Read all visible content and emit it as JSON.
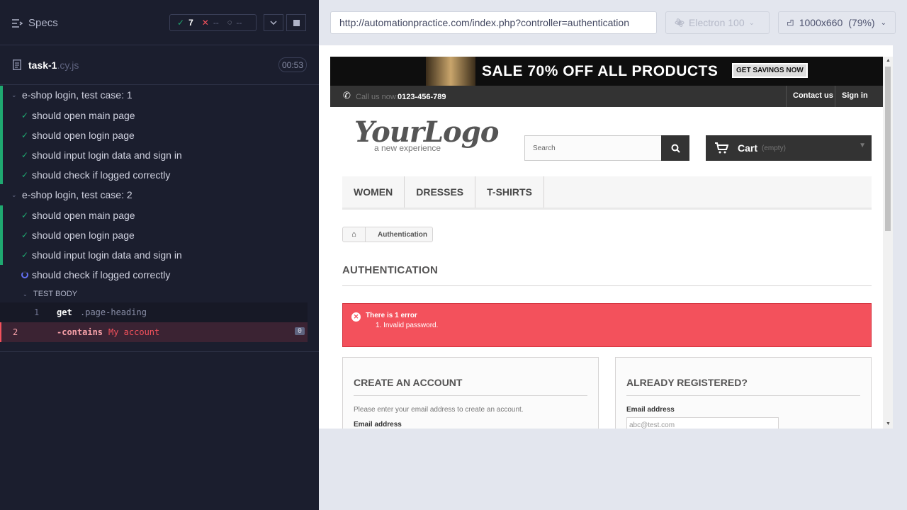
{
  "header": {
    "specs_label": "Specs",
    "passed_count": "7",
    "failed_count": "--",
    "pending_count": "--"
  },
  "spec_file": {
    "name": "task-1",
    "ext": ".cy.js",
    "duration": "00:53"
  },
  "suites": [
    {
      "title": "e-shop login, test case: 1",
      "tests": [
        "should open main page",
        "should open login page",
        "should input login data and sign in",
        "should check if logged correctly"
      ]
    },
    {
      "title": "e-shop login, test case: 2",
      "tests": [
        "should open main page",
        "should open login page",
        "should input login data and sign in",
        "should check if logged correctly"
      ]
    }
  ],
  "test_body": {
    "label": "TEST BODY",
    "commands": [
      {
        "num": "1",
        "name": "get",
        "arg": ".page-heading"
      },
      {
        "num": "2",
        "name": "-contains",
        "arg": "My account",
        "badge": "0"
      }
    ]
  },
  "browser": {
    "url": "http://automationpractice.com/index.php?controller=authentication",
    "browser_name": "Electron 100",
    "viewport": "1000x660",
    "zoom": "(79%)"
  },
  "site": {
    "banner_text": "SALE 70% OFF ALL PRODUCTS",
    "banner_button": "GET SAVINGS NOW",
    "call_label": "Call us now:",
    "phone": "0123-456-789",
    "contact_link": "Contact us",
    "signin_link": "Sign in",
    "logo_text": "YourLogo",
    "logo_tagline": "a new experience",
    "search_placeholder": "Search",
    "cart_label": "Cart",
    "cart_state": "(empty)",
    "menu": [
      "WOMEN",
      "DRESSES",
      "T-SHIRTS"
    ],
    "breadcrumb": "Authentication",
    "page_heading": "AUTHENTICATION",
    "error_title": "There is 1 error",
    "error_item": "1. Invalid password.",
    "create_title": "CREATE AN ACCOUNT",
    "create_text": "Please enter your email address to create an account.",
    "create_email_label": "Email address",
    "registered_title": "ALREADY REGISTERED?",
    "registered_email_label": "Email address",
    "registered_email_value": "abc@test.com"
  },
  "colors": {
    "pass": "#1fa971",
    "fail": "#f3515c",
    "sidebar_bg": "#1b1e2e",
    "running": "#6470f3"
  }
}
